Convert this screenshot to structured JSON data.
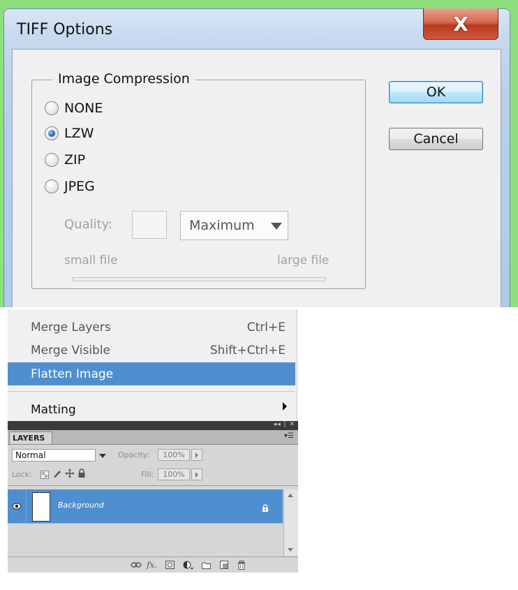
{
  "dialog": {
    "title": "TIFF Options",
    "close_label": "X",
    "group_label": "Image Compression",
    "options": [
      {
        "label": "NONE",
        "checked": false
      },
      {
        "label": "LZW",
        "checked": true
      },
      {
        "label": "ZIP",
        "checked": false
      },
      {
        "label": "JPEG",
        "checked": false
      }
    ],
    "quality_label": "Quality:",
    "quality_value": "",
    "quality_select": "Maximum",
    "small_file_label": "small file",
    "large_file_label": "large file",
    "ok_label": "OK",
    "cancel_label": "Cancel"
  },
  "menu": {
    "items": [
      {
        "label": "Merge Layers",
        "shortcut": "Ctrl+E"
      },
      {
        "label": "Merge Visible",
        "shortcut": "Shift+Ctrl+E"
      },
      {
        "label": "Flatten Image",
        "shortcut": ""
      },
      {
        "label": "Matting",
        "shortcut": ""
      }
    ]
  },
  "layers_panel": {
    "tab_label": "LAYERS",
    "blend_mode": "Normal",
    "opacity_label": "Opacity:",
    "opacity_value": "100%",
    "lock_label": "Lock:",
    "fill_label": "Fill:",
    "fill_value": "100%",
    "layer_name": "Background",
    "panel_controls": "◂◂ | ✕",
    "icons": [
      "link-icon",
      "fx-icon",
      "mask-icon",
      "adjustment-icon",
      "folder-icon",
      "new-layer-icon",
      "trash-icon"
    ]
  },
  "colors": {
    "highlight": "#4f8fd0",
    "background_green": "#8ee07e",
    "close_red": "#c64a2f"
  }
}
